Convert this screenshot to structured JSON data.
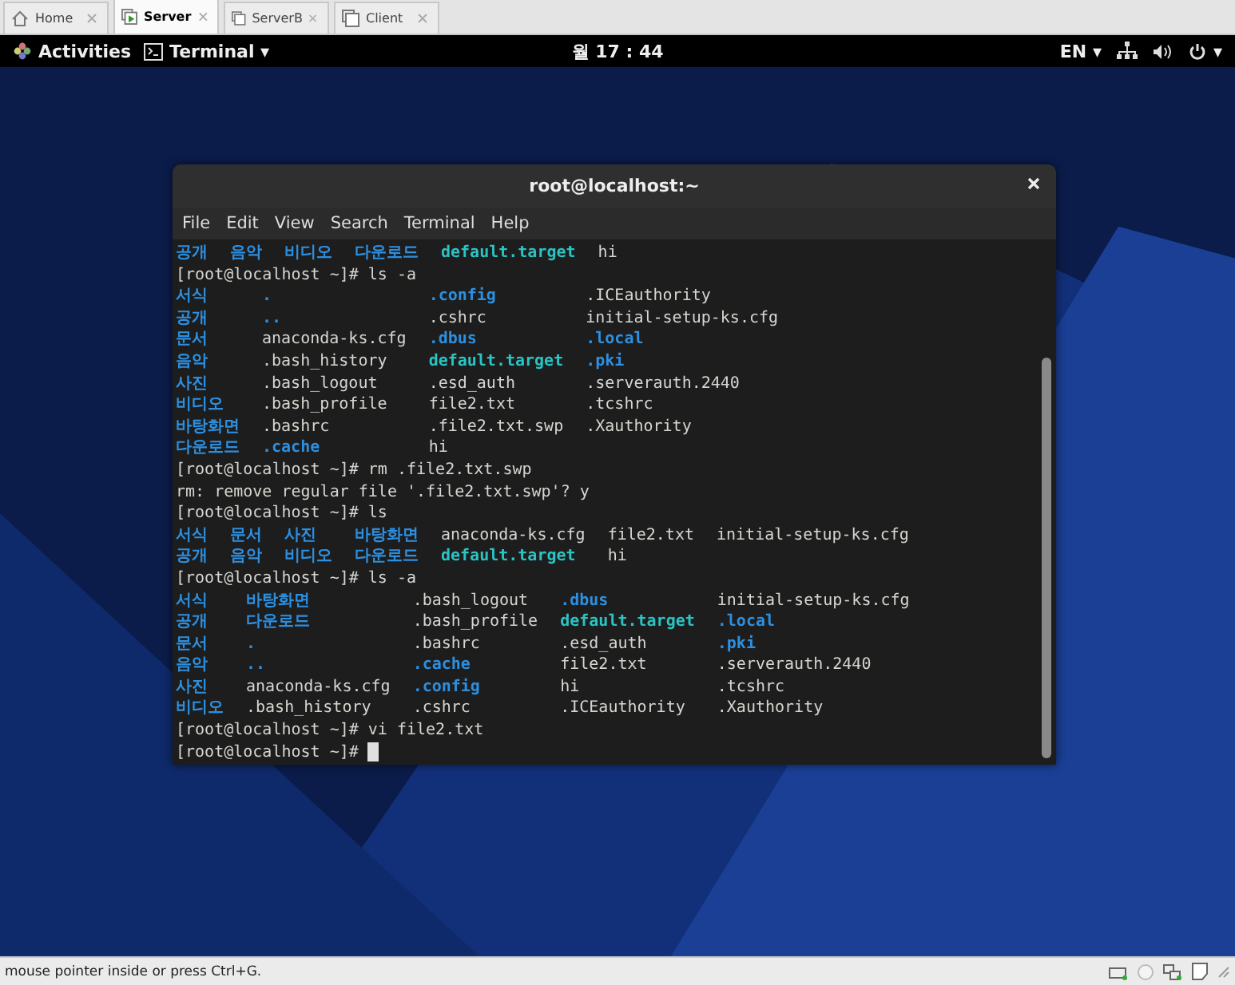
{
  "vm_tabs": [
    {
      "label": "Home",
      "kind": "home",
      "selected": false
    },
    {
      "label": "Server",
      "kind": "running",
      "selected": true
    },
    {
      "label": "ServerB",
      "kind": "vm",
      "selected": false
    },
    {
      "label": "Client",
      "kind": "vm",
      "selected": false
    }
  ],
  "top_bar": {
    "activities": "Activities",
    "app_menu": "Terminal ▾",
    "clock": "월 17 : 44",
    "input_source": "EN ▾",
    "system_menu_caret": "▾"
  },
  "terminal": {
    "title": "root@localhost:~",
    "menu": [
      "File",
      "Edit",
      "View",
      "Search",
      "Terminal",
      "Help"
    ],
    "cursor_visible": true,
    "blocks": [
      {
        "kind": "listing",
        "rows": [
          [
            {
              "text": "공개",
              "kind": "dir"
            },
            {
              "text": "음악",
              "kind": "dir"
            },
            {
              "text": "비디오",
              "kind": "dir"
            },
            {
              "text": "다운로드",
              "kind": "dir"
            },
            {
              "text": "default.target",
              "kind": "link"
            },
            {
              "text": "hi",
              "kind": "file"
            }
          ]
        ]
      },
      {
        "kind": "line",
        "text": "[root@localhost ~]# ls -a"
      },
      {
        "kind": "listing",
        "rows": [
          [
            {
              "text": "서식",
              "kind": "dir"
            },
            {
              "text": ".",
              "kind": "dir"
            },
            {
              "text": ".config",
              "kind": "dir"
            },
            {
              "text": ".ICEauthority",
              "kind": "file"
            }
          ],
          [
            {
              "text": "공개",
              "kind": "dir"
            },
            {
              "text": "..",
              "kind": "dir"
            },
            {
              "text": ".cshrc",
              "kind": "file"
            },
            {
              "text": "initial-setup-ks.cfg",
              "kind": "file"
            }
          ],
          [
            {
              "text": "문서",
              "kind": "dir"
            },
            {
              "text": "anaconda-ks.cfg",
              "kind": "file"
            },
            {
              "text": ".dbus",
              "kind": "dir"
            },
            {
              "text": ".local",
              "kind": "dir"
            }
          ],
          [
            {
              "text": "음악",
              "kind": "dir"
            },
            {
              "text": ".bash_history",
              "kind": "file"
            },
            {
              "text": "default.target",
              "kind": "link"
            },
            {
              "text": ".pki",
              "kind": "dir"
            }
          ],
          [
            {
              "text": "사진",
              "kind": "dir"
            },
            {
              "text": ".bash_logout",
              "kind": "file"
            },
            {
              "text": ".esd_auth",
              "kind": "file"
            },
            {
              "text": ".serverauth.2440",
              "kind": "file"
            }
          ],
          [
            {
              "text": "비디오",
              "kind": "dir"
            },
            {
              "text": ".bash_profile",
              "kind": "file"
            },
            {
              "text": "file2.txt",
              "kind": "file"
            },
            {
              "text": ".tcshrc",
              "kind": "file"
            }
          ],
          [
            {
              "text": "바탕화면",
              "kind": "dir"
            },
            {
              "text": ".bashrc",
              "kind": "file"
            },
            {
              "text": ".file2.txt.swp",
              "kind": "file"
            },
            {
              "text": ".Xauthority",
              "kind": "file"
            }
          ],
          [
            {
              "text": "다운로드",
              "kind": "dir"
            },
            {
              "text": ".cache",
              "kind": "dir"
            },
            {
              "text": "hi",
              "kind": "file"
            }
          ]
        ]
      },
      {
        "kind": "line",
        "text": "[root@localhost ~]# rm .file2.txt.swp"
      },
      {
        "kind": "line",
        "text": "rm: remove regular file '.file2.txt.swp'? y"
      },
      {
        "kind": "line",
        "text": "[root@localhost ~]# ls"
      },
      {
        "kind": "listing",
        "rows": [
          [
            {
              "text": "서식",
              "kind": "dir"
            },
            {
              "text": "문서",
              "kind": "dir"
            },
            {
              "text": "사진",
              "kind": "dir"
            },
            {
              "text": "바탕화면",
              "kind": "dir"
            },
            {
              "text": "anaconda-ks.cfg",
              "kind": "file"
            },
            {
              "text": "file2.txt",
              "kind": "file"
            },
            {
              "text": "initial-setup-ks.cfg",
              "kind": "file"
            }
          ],
          [
            {
              "text": "공개",
              "kind": "dir"
            },
            {
              "text": "음악",
              "kind": "dir"
            },
            {
              "text": "비디오",
              "kind": "dir"
            },
            {
              "text": "다운로드",
              "kind": "dir"
            },
            {
              "text": "default.target",
              "kind": "link"
            },
            {
              "text": "hi",
              "kind": "file"
            }
          ]
        ]
      },
      {
        "kind": "line",
        "text": "[root@localhost ~]# ls -a"
      },
      {
        "kind": "listing",
        "rows": [
          [
            {
              "text": "서식",
              "kind": "dir"
            },
            {
              "text": "바탕화면",
              "kind": "dir"
            },
            {
              "text": ".bash_logout",
              "kind": "file"
            },
            {
              "text": ".dbus",
              "kind": "dir"
            },
            {
              "text": "initial-setup-ks.cfg",
              "kind": "file"
            }
          ],
          [
            {
              "text": "공개",
              "kind": "dir"
            },
            {
              "text": "다운로드",
              "kind": "dir"
            },
            {
              "text": ".bash_profile",
              "kind": "file"
            },
            {
              "text": "default.target",
              "kind": "link"
            },
            {
              "text": ".local",
              "kind": "dir"
            }
          ],
          [
            {
              "text": "문서",
              "kind": "dir"
            },
            {
              "text": ".",
              "kind": "dir"
            },
            {
              "text": ".bashrc",
              "kind": "file"
            },
            {
              "text": ".esd_auth",
              "kind": "file"
            },
            {
              "text": ".pki",
              "kind": "dir"
            }
          ],
          [
            {
              "text": "음악",
              "kind": "dir"
            },
            {
              "text": "..",
              "kind": "dir"
            },
            {
              "text": ".cache",
              "kind": "dir"
            },
            {
              "text": "file2.txt",
              "kind": "file"
            },
            {
              "text": ".serverauth.2440",
              "kind": "file"
            }
          ],
          [
            {
              "text": "사진",
              "kind": "dir"
            },
            {
              "text": "anaconda-ks.cfg",
              "kind": "file"
            },
            {
              "text": ".config",
              "kind": "dir"
            },
            {
              "text": "hi",
              "kind": "file"
            },
            {
              "text": ".tcshrc",
              "kind": "file"
            }
          ],
          [
            {
              "text": "비디오",
              "kind": "dir"
            },
            {
              "text": ".bash_history",
              "kind": "file"
            },
            {
              "text": ".cshrc",
              "kind": "file"
            },
            {
              "text": ".ICEauthority",
              "kind": "file"
            },
            {
              "text": ".Xauthority",
              "kind": "file"
            }
          ]
        ]
      },
      {
        "kind": "line",
        "text": "[root@localhost ~]# vi file2.txt"
      },
      {
        "kind": "line",
        "text": "[root@localhost ~]# "
      }
    ]
  },
  "status_bar": {
    "hint": "mouse pointer inside or press Ctrl+G."
  }
}
